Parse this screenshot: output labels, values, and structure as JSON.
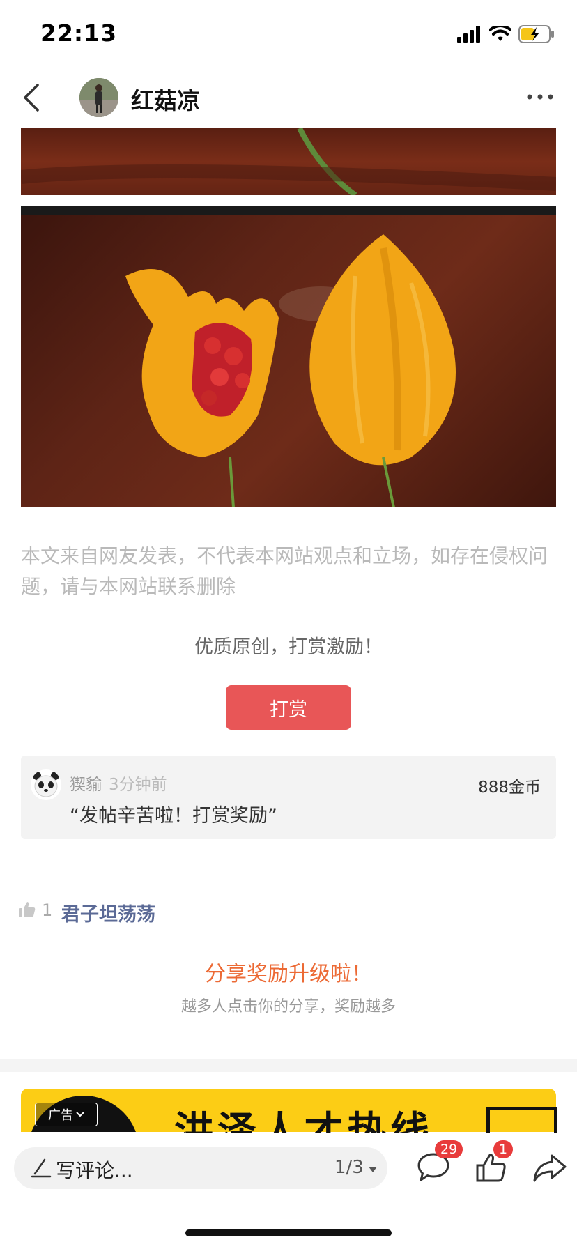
{
  "status_bar": {
    "time": "22:13"
  },
  "header": {
    "username": "红菇凉"
  },
  "post": {
    "disclaimer": "本文来自网友发表，不代表本网站观点和立场，如存在侵权问题，请与本网站联系删除",
    "reward_prompt": "优质原创，打赏激励！",
    "reward_button": "打赏"
  },
  "reward_record": {
    "name": "猰貐",
    "time": "3分钟前",
    "amount": "888金币",
    "message": "“发帖辛苦啦！打赏奖励”"
  },
  "likes": {
    "count": "1",
    "user": "君子坦荡荡"
  },
  "share": {
    "title": "分享奖励升级啦！",
    "subtitle": "越多人点击你的分享，奖励越多"
  },
  "ad": {
    "tag": "广告",
    "text": "洪泽人才热线"
  },
  "bottom_bar": {
    "comment_placeholder": "写评论...",
    "page_indicator": "1/3",
    "comment_count": "29",
    "like_count": "1"
  },
  "colors": {
    "reward_button": "#e85657",
    "share_title": "#ec6a35",
    "liker": "#5b6a96",
    "badge": "#e83b3b",
    "ad_banner": "#fccd15"
  }
}
